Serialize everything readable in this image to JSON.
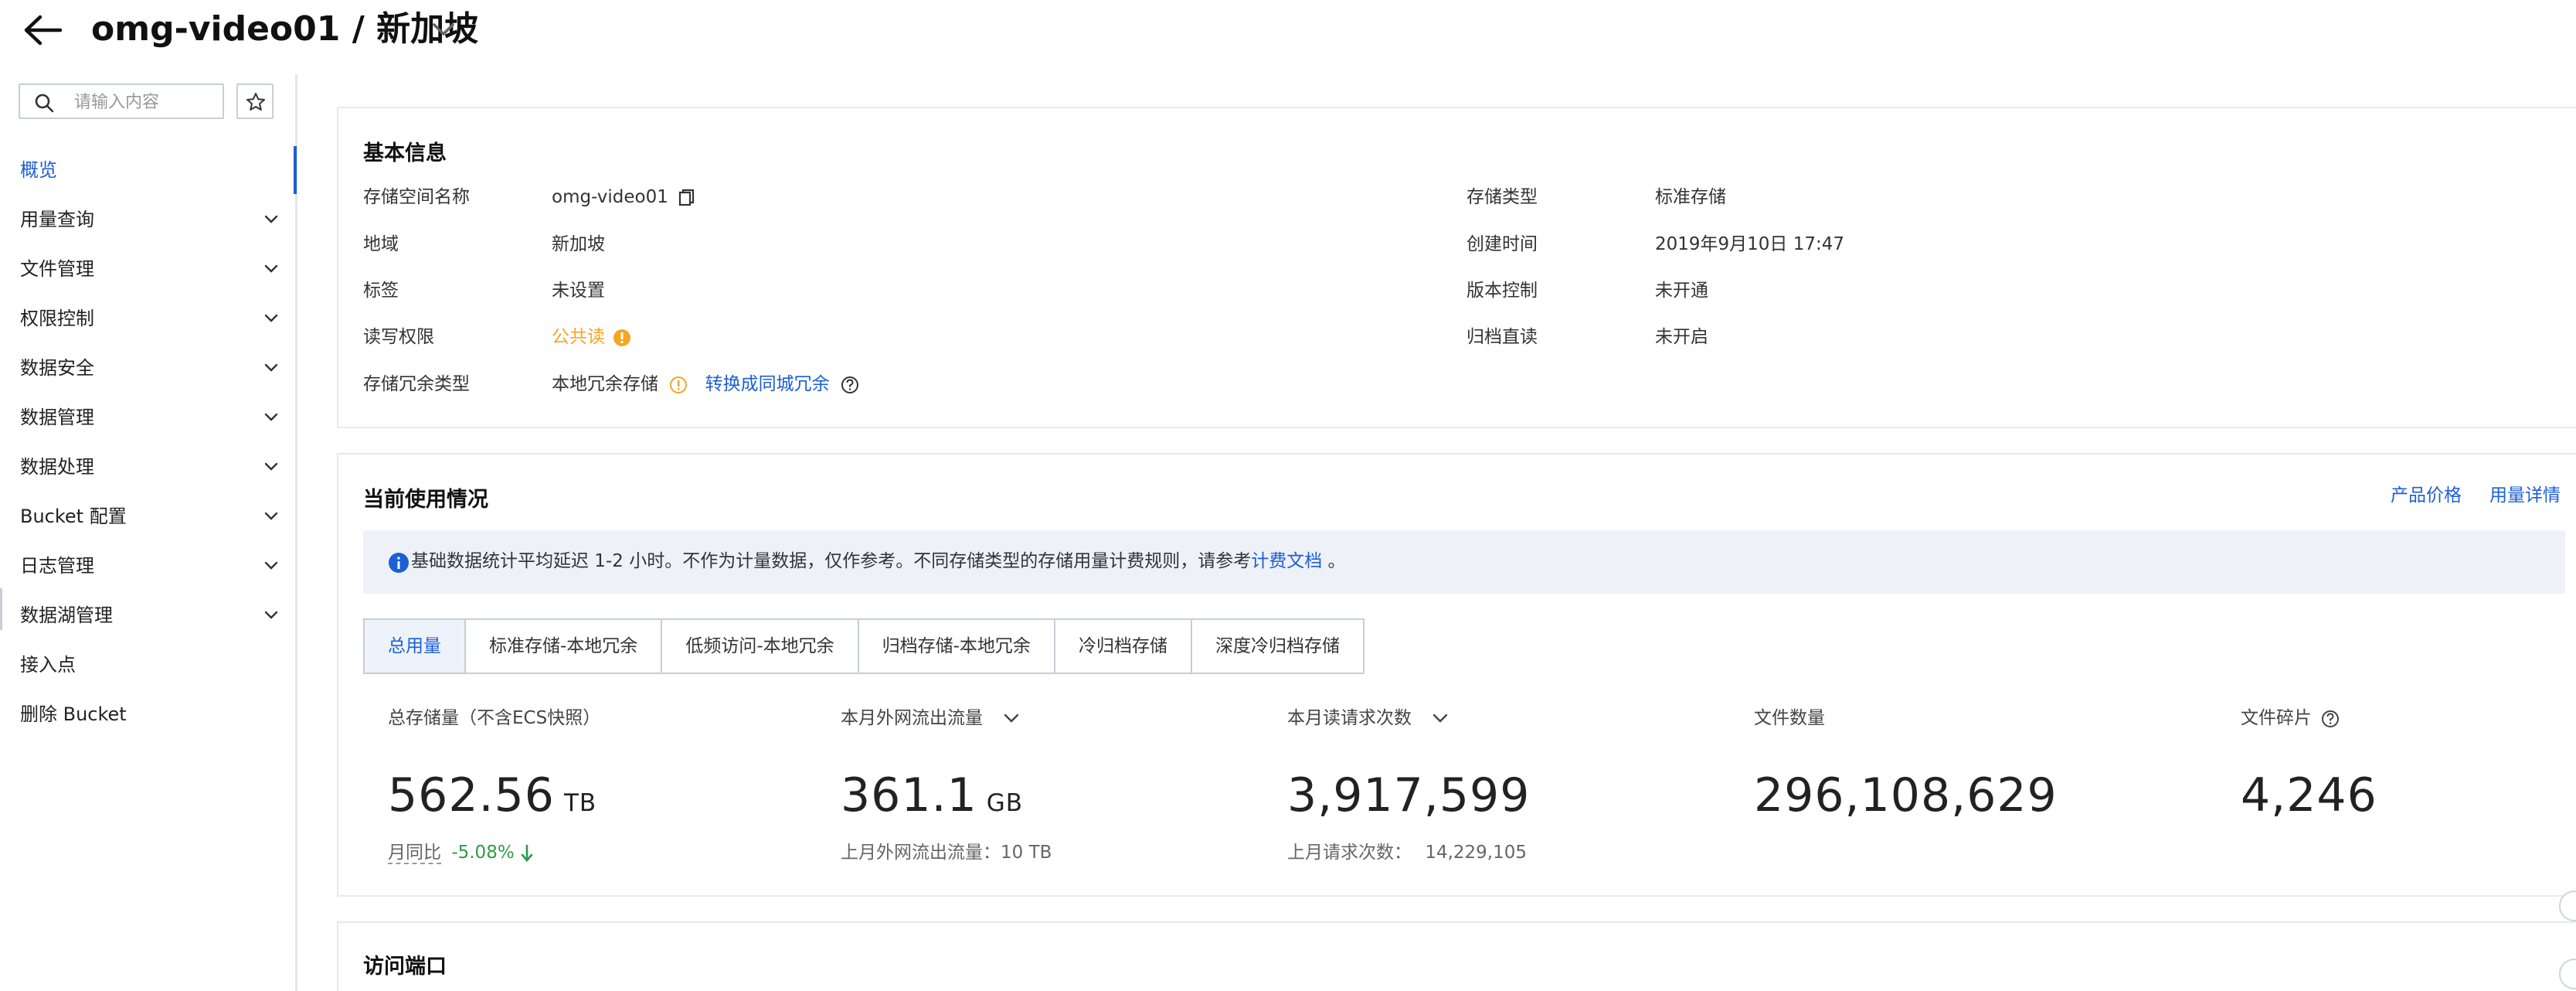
{
  "header": {
    "title": "omg-video01 / 新加坡"
  },
  "sidebar": {
    "search_placeholder": "请输入内容",
    "items": [
      {
        "label": "概览"
      },
      {
        "label": "用量查询"
      },
      {
        "label": "文件管理"
      },
      {
        "label": "权限控制"
      },
      {
        "label": "数据安全"
      },
      {
        "label": "数据管理"
      },
      {
        "label": "数据处理"
      },
      {
        "label": "Bucket 配置"
      },
      {
        "label": "日志管理"
      },
      {
        "label": "数据湖管理"
      },
      {
        "label": "接入点"
      },
      {
        "label": "删除 Bucket"
      }
    ]
  },
  "basic_info": {
    "title": "基本信息",
    "bucket_name_key": "存储空间名称",
    "bucket_name_val": "omg-video01",
    "region_key": "地域",
    "region_val": "新加坡",
    "tag_key": "标签",
    "tag_val": "未设置",
    "acl_key": "读写权限",
    "acl_val": "公共读",
    "redundancy_key": "存储冗余类型",
    "redundancy_val": "本地冗余存储",
    "redundancy_link": "转换成同城冗余",
    "storage_class_key": "存储类型",
    "storage_class_val": "标准存储",
    "created_key": "创建时间",
    "created_val": "2019年9月10日 17:47",
    "versioning_key": "版本控制",
    "versioning_val": "未开通",
    "archive_key": "归档直读",
    "archive_val": "未开启"
  },
  "usage": {
    "title": "当前使用情况",
    "price_link": "产品价格",
    "detail_link": "用量详情",
    "notice_text": "基础数据统计平均延迟 1-2 小时。不作为计量数据，仅作参考。不同存储类型的存储用量计费规则，请参考",
    "notice_link": "计费文档",
    "notice_end": "。",
    "tabs": [
      "总用量",
      "标准存储-本地冗余",
      "低频访问-本地冗余",
      "归档存储-本地冗余",
      "冷归档存储",
      "深度冷归档存储"
    ],
    "storage_label": "总存储量（不含ECS快照）",
    "storage_value": "562.56",
    "storage_unit": "TB",
    "mom_label": "月同比",
    "mom_value": "-5.08%",
    "traffic_label": "本月外网流出流量",
    "traffic_value": "361.1",
    "traffic_unit": "GB",
    "traffic_last": "上月外网流出流量：10 TB",
    "requests_label": "本月读请求次数",
    "requests_value": "3,917,599",
    "requests_last_label": "上月请求次数：",
    "requests_last_value": "14,229,105",
    "files_label": "文件数量",
    "files_value": "296,108,629",
    "fragments_label": "文件碎片",
    "fragments_value": "4,246"
  },
  "endpoint": {
    "title": "访问端口"
  },
  "colors": {
    "accent": "#1c5fd6",
    "warning": "#f5a623",
    "positive": "#2e9b48"
  }
}
